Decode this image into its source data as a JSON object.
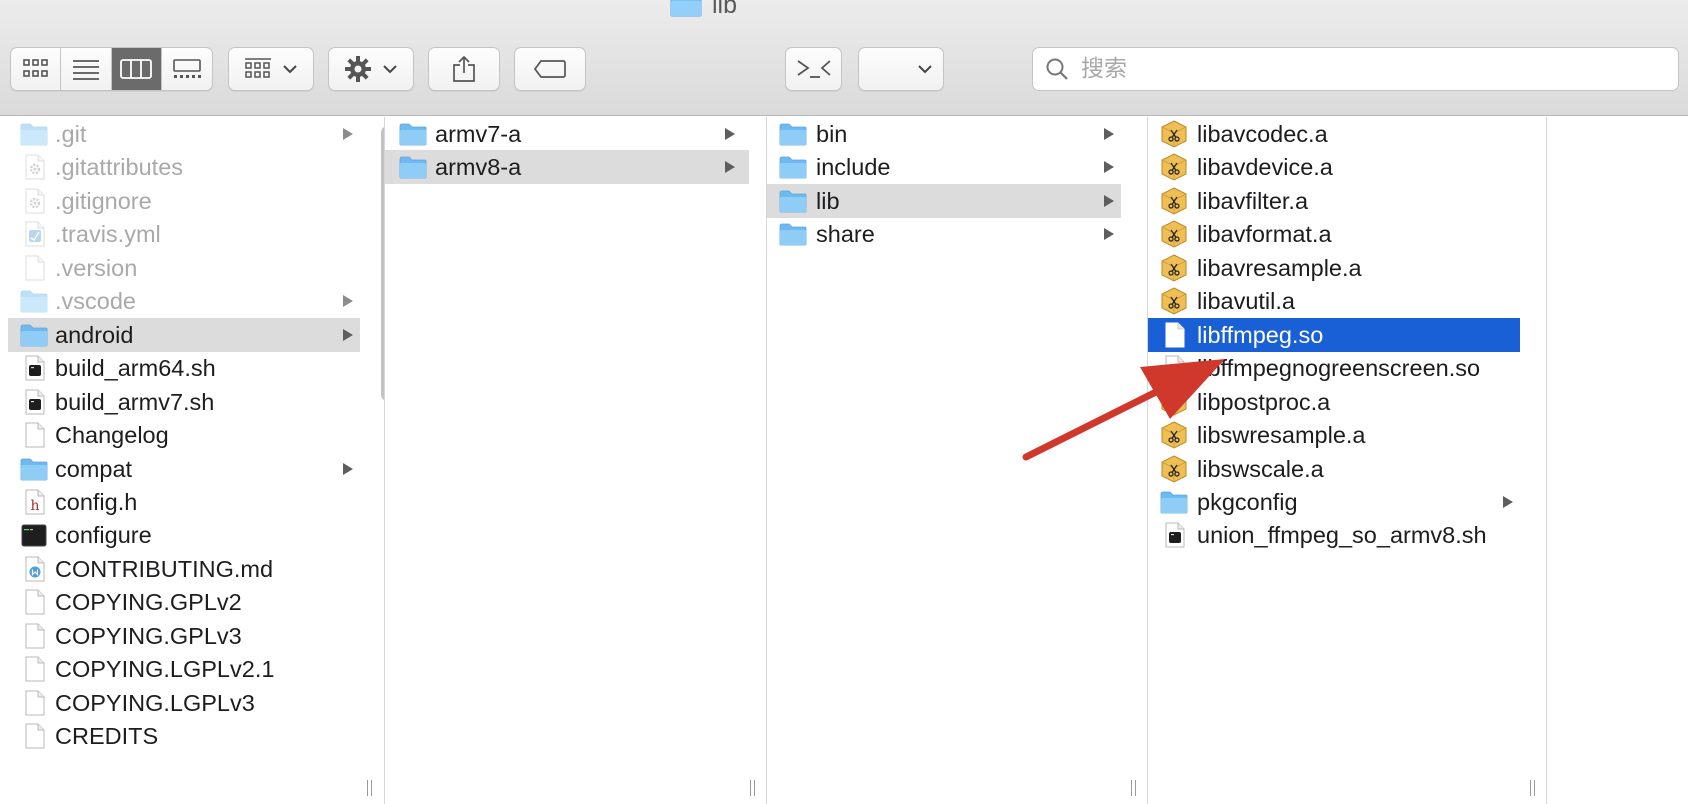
{
  "window": {
    "title": "lib"
  },
  "toolbar": {
    "view_buttons": [
      {
        "name": "icon-view",
        "active": false
      },
      {
        "name": "list-view",
        "active": false
      },
      {
        "name": "column-view",
        "active": true
      },
      {
        "name": "gallery-view",
        "active": false
      }
    ],
    "search": {
      "placeholder": "搜索",
      "value": ""
    }
  },
  "columns": [
    {
      "name": "root",
      "items": [
        {
          "label": ".git",
          "icon": "folder-icon",
          "folder": true,
          "dim": true
        },
        {
          "label": ".gitattributes",
          "icon": "gear-file-icon",
          "folder": false,
          "dim": true
        },
        {
          "label": ".gitignore",
          "icon": "gear-file-icon",
          "folder": false,
          "dim": true
        },
        {
          "label": ".travis.yml",
          "icon": "yaml-file-icon",
          "folder": false,
          "dim": true
        },
        {
          "label": ".version",
          "icon": "blank-file-icon",
          "folder": false,
          "dim": true
        },
        {
          "label": ".vscode",
          "icon": "folder-icon",
          "folder": true,
          "dim": true
        },
        {
          "label": "android",
          "icon": "folder-icon",
          "folder": true,
          "dim": false,
          "selected": "gray"
        },
        {
          "label": "build_arm64.sh",
          "icon": "shell-script-icon",
          "folder": false,
          "dim": false
        },
        {
          "label": "build_armv7.sh",
          "icon": "shell-script-icon",
          "folder": false,
          "dim": false
        },
        {
          "label": "Changelog",
          "icon": "blank-file-icon",
          "folder": false,
          "dim": false
        },
        {
          "label": "compat",
          "icon": "folder-icon",
          "folder": true,
          "dim": false
        },
        {
          "label": "config.h",
          "icon": "header-file-icon",
          "folder": false,
          "dim": false
        },
        {
          "label": "configure",
          "icon": "terminal-exec-icon",
          "folder": false,
          "dim": false
        },
        {
          "label": "CONTRIBUTING.md",
          "icon": "markdown-file-icon",
          "folder": false,
          "dim": false
        },
        {
          "label": "COPYING.GPLv2",
          "icon": "blank-file-icon",
          "folder": false,
          "dim": false
        },
        {
          "label": "COPYING.GPLv3",
          "icon": "blank-file-icon",
          "folder": false,
          "dim": false
        },
        {
          "label": "COPYING.LGPLv2.1",
          "icon": "blank-file-icon",
          "folder": false,
          "dim": false
        },
        {
          "label": "COPYING.LGPLv3",
          "icon": "blank-file-icon",
          "folder": false,
          "dim": false
        },
        {
          "label": "CREDITS",
          "icon": "blank-file-icon",
          "folder": false,
          "dim": false
        }
      ]
    },
    {
      "name": "android",
      "items": [
        {
          "label": "armv7-a",
          "icon": "folder-icon",
          "folder": true,
          "dim": false
        },
        {
          "label": "armv8-a",
          "icon": "folder-icon",
          "folder": true,
          "dim": false,
          "selected": "gray"
        }
      ]
    },
    {
      "name": "armv8-a",
      "items": [
        {
          "label": "bin",
          "icon": "folder-icon",
          "folder": true,
          "dim": false
        },
        {
          "label": "include",
          "icon": "folder-icon",
          "folder": true,
          "dim": false
        },
        {
          "label": "lib",
          "icon": "folder-icon",
          "folder": true,
          "dim": false,
          "selected": "gray"
        },
        {
          "label": "share",
          "icon": "folder-icon",
          "folder": true,
          "dim": false
        }
      ]
    },
    {
      "name": "lib",
      "items": [
        {
          "label": "libavcodec.a",
          "icon": "archive-file-icon",
          "folder": false,
          "dim": false
        },
        {
          "label": "libavdevice.a",
          "icon": "archive-file-icon",
          "folder": false,
          "dim": false
        },
        {
          "label": "libavfilter.a",
          "icon": "archive-file-icon",
          "folder": false,
          "dim": false
        },
        {
          "label": "libavformat.a",
          "icon": "archive-file-icon",
          "folder": false,
          "dim": false
        },
        {
          "label": "libavresample.a",
          "icon": "archive-file-icon",
          "folder": false,
          "dim": false
        },
        {
          "label": "libavutil.a",
          "icon": "archive-file-icon",
          "folder": false,
          "dim": false
        },
        {
          "label": "libffmpeg.so",
          "icon": "blank-file-icon",
          "folder": false,
          "dim": false,
          "selected": "blue"
        },
        {
          "label": "libffmpegnogreenscreen.so",
          "icon": "blank-file-icon",
          "folder": false,
          "dim": false
        },
        {
          "label": "libpostproc.a",
          "icon": "archive-file-icon",
          "folder": false,
          "dim": false
        },
        {
          "label": "libswresample.a",
          "icon": "archive-file-icon",
          "folder": false,
          "dim": false
        },
        {
          "label": "libswscale.a",
          "icon": "archive-file-icon",
          "folder": false,
          "dim": false
        },
        {
          "label": "pkgconfig",
          "icon": "folder-icon",
          "folder": true,
          "dim": false
        },
        {
          "label": "union_ffmpeg_so_armv8.sh",
          "icon": "shell-script-icon",
          "folder": false,
          "dim": false
        }
      ]
    }
  ],
  "colors": {
    "selection_blue": "#1960d6",
    "selection_gray": "#dcdcdc",
    "annotation_arrow": "#d0382b",
    "folder_blue": "#7cc2f5"
  }
}
